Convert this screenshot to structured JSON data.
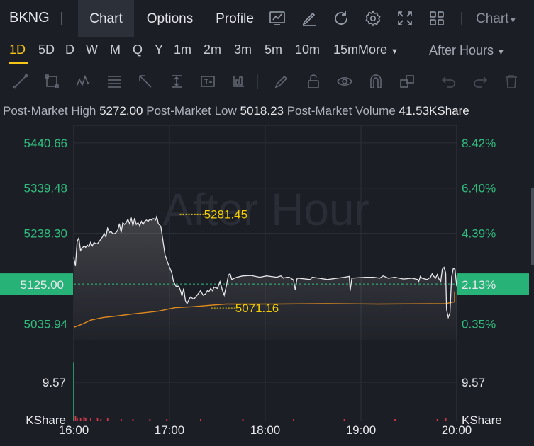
{
  "header": {
    "ticker": "BKNG",
    "tabs": [
      "Chart",
      "Options",
      "Profile"
    ],
    "chart_dropdown": "Chart",
    "icons": [
      "indicator-icon",
      "draw-icon",
      "refresh-icon",
      "settings-icon",
      "fullscreen-icon",
      "layout-grid-icon"
    ]
  },
  "timeframes": {
    "items": [
      "1D",
      "5D",
      "D",
      "W",
      "M",
      "Q",
      "Y",
      "1m",
      "2m",
      "3m",
      "5m",
      "10m",
      "15m"
    ],
    "more_label": "More",
    "selected": "1D",
    "session": "After Hours"
  },
  "drawing_tools": [
    "line-tool-icon",
    "rectangle-tool-icon",
    "pattern-tool-icon",
    "fibonacci-tool-icon",
    "arrow-tool-icon",
    "price-range-tool-icon",
    "text-tool-icon",
    "forecast-tool-icon",
    "pencil-icon",
    "lock-icon",
    "eye-icon",
    "magnet-icon",
    "duplicate-icon",
    "undo-icon",
    "redo-icon",
    "trash-icon"
  ],
  "stats": {
    "high_label": "Post-Market High",
    "high_value": "5272.00",
    "low_label": "Post-Market Low",
    "low_value": "5018.23",
    "volume_label": "Post-Market Volume",
    "volume_value": "41.53KShare"
  },
  "watermark": "After Hour",
  "colors": {
    "accent": "#f5c518",
    "green": "#2fbe7f",
    "price_line": "#e6e8ec",
    "avg_line": "#e08a1e",
    "background": "#1c1e25"
  },
  "chart_data": {
    "type": "line",
    "x_ticks": [
      "16:00",
      "17:00",
      "18:00",
      "19:00",
      "20:00"
    ],
    "y_ticks": [
      "5440.66",
      "5339.48",
      "5238.30",
      "5035.94"
    ],
    "pct_ticks": [
      "8.42%",
      "6.40%",
      "4.39%",
      "0.35%"
    ],
    "ylim": [
      5000,
      5480
    ],
    "xlim": [
      0,
      240
    ],
    "current_price": "5125.00",
    "current_pct": "2.13%",
    "high_marker": {
      "t": 61,
      "price": 5281.45,
      "label": "5281.45"
    },
    "low_marker": {
      "t": 79,
      "price": 5071.16,
      "label": "5071.16"
    },
    "series": [
      {
        "points": [
          [
            0,
            5185
          ],
          [
            2,
            5165
          ],
          [
            4,
            5220
          ],
          [
            6,
            5228
          ],
          [
            8,
            5200
          ],
          [
            10,
            5205
          ],
          [
            12,
            5210
          ],
          [
            14,
            5207
          ],
          [
            16,
            5212
          ],
          [
            18,
            5208
          ],
          [
            20,
            5218
          ],
          [
            22,
            5210
          ],
          [
            24,
            5218
          ],
          [
            26,
            5215
          ],
          [
            28,
            5215
          ],
          [
            30,
            5220
          ],
          [
            32,
            5225
          ],
          [
            34,
            5230
          ],
          [
            36,
            5238
          ],
          [
            38,
            5230
          ],
          [
            40,
            5250
          ],
          [
            42,
            5240
          ],
          [
            44,
            5242
          ],
          [
            46,
            5238
          ],
          [
            48,
            5237
          ],
          [
            50,
            5240
          ],
          [
            52,
            5245
          ],
          [
            54,
            5260
          ],
          [
            56,
            5240
          ],
          [
            58,
            5262
          ],
          [
            60,
            5258
          ],
          [
            62,
            5262
          ],
          [
            64,
            5270
          ],
          [
            66,
            5260
          ],
          [
            68,
            5272
          ],
          [
            70,
            5255
          ],
          [
            72,
            5272
          ],
          [
            74,
            5258
          ],
          [
            76,
            5262
          ],
          [
            78,
            5255
          ],
          [
            80,
            5265
          ],
          [
            82,
            5258
          ],
          [
            84,
            5265
          ],
          [
            86,
            5268
          ],
          [
            88,
            5265
          ],
          [
            90,
            5270
          ],
          [
            92,
            5268
          ],
          [
            94,
            5271
          ],
          [
            96,
            5270
          ],
          [
            97,
            5268
          ],
          [
            98,
            5275
          ],
          [
            99,
            5270
          ],
          [
            100,
            5260
          ],
          [
            103,
            5254
          ],
          [
            108,
            5190
          ],
          [
            112,
            5168
          ],
          [
            116,
            5150
          ],
          [
            118,
            5130
          ],
          [
            121,
            5120
          ],
          [
            124,
            5120
          ],
          [
            126,
            5112
          ],
          [
            128,
            5098
          ],
          [
            130,
            5115
          ],
          [
            132,
            5088
          ],
          [
            134,
            5081
          ],
          [
            138,
            5096
          ],
          [
            142,
            5091
          ],
          [
            146,
            5100
          ],
          [
            150,
            5110
          ],
          [
            153,
            5100
          ],
          [
            156,
            5103
          ],
          [
            158,
            5110
          ],
          [
            160,
            5108
          ],
          [
            162,
            5115
          ],
          [
            164,
            5110
          ],
          [
            166,
            5118
          ],
          [
            170,
            5115
          ],
          [
            173,
            5130
          ],
          [
            176,
            5110
          ],
          [
            178,
            5100
          ],
          [
            181,
            5125
          ],
          [
            183,
            5145
          ],
          [
            185,
            5148
          ],
          [
            187,
            5135
          ],
          [
            190,
            5138
          ],
          [
            193,
            5140
          ],
          [
            200,
            5143
          ],
          [
            210,
            5144
          ],
          [
            220,
            5140
          ],
          [
            228,
            5143
          ],
          [
            240,
            5140
          ],
          [
            245,
            5143
          ],
          [
            248,
            5138
          ],
          [
            252,
            5140
          ],
          [
            255,
            5140
          ],
          [
            260,
            5134
          ],
          [
            262,
            5112
          ],
          [
            264,
            5136
          ],
          [
            265,
            5138
          ],
          [
            280,
            5135
          ],
          [
            282,
            5140
          ],
          [
            290,
            5138
          ],
          [
            300,
            5135
          ],
          [
            312,
            5138
          ],
          [
            320,
            5140
          ],
          [
            326,
            5142
          ],
          [
            327,
            5110
          ],
          [
            329,
            5138
          ],
          [
            345,
            5140
          ],
          [
            355,
            5140
          ],
          [
            362,
            5138
          ],
          [
            366,
            5143
          ],
          [
            372,
            5138
          ],
          [
            380,
            5140
          ],
          [
            390,
            5136
          ],
          [
            400,
            5138
          ],
          [
            407,
            5135
          ],
          [
            408,
            5130
          ],
          [
            410,
            5142
          ],
          [
            412,
            5138
          ],
          [
            418,
            5135
          ],
          [
            422,
            5140
          ],
          [
            424,
            5148
          ],
          [
            426,
            5142
          ],
          [
            428,
            5138
          ],
          [
            430,
            5146
          ],
          [
            432,
            5136
          ],
          [
            434,
            5130
          ],
          [
            436,
            5158
          ],
          [
            438,
            5162
          ],
          [
            440,
            5150
          ],
          [
            441,
            5068
          ],
          [
            443,
            5050
          ],
          [
            445,
            5060
          ],
          [
            447,
            5140
          ],
          [
            449,
            5160
          ],
          [
            451,
            5158
          ],
          [
            453,
            5120
          ]
        ]
      },
      {
        "points": [
          [
            0,
            5028
          ],
          [
            10,
            5035
          ],
          [
            20,
            5044
          ],
          [
            35,
            5050
          ],
          [
            50,
            5053
          ],
          [
            70,
            5058
          ],
          [
            90,
            5062
          ],
          [
            100,
            5064
          ],
          [
            110,
            5068
          ],
          [
            120,
            5072
          ],
          [
            140,
            5074
          ],
          [
            180,
            5080
          ],
          [
            240,
            5080
          ],
          [
            300,
            5081
          ],
          [
            360,
            5080
          ],
          [
            440,
            5081
          ],
          [
            453,
            5085
          ],
          [
            460,
            5108
          ]
        ]
      }
    ],
    "volume": {
      "y_tick": "9.57",
      "unit": "KShare",
      "bars": [
        [
          0,
          80
        ],
        [
          2,
          6
        ],
        [
          4,
          4
        ],
        [
          8,
          3
        ],
        [
          12,
          5
        ],
        [
          14,
          4
        ],
        [
          20,
          3
        ],
        [
          28,
          4
        ],
        [
          32,
          2
        ],
        [
          40,
          3
        ],
        [
          56,
          2
        ],
        [
          70,
          2
        ],
        [
          90,
          2
        ],
        [
          110,
          2
        ],
        [
          150,
          2
        ],
        [
          200,
          2
        ],
        [
          260,
          2
        ],
        [
          320,
          2
        ],
        [
          380,
          2
        ],
        [
          430,
          2
        ],
        [
          440,
          3
        ]
      ]
    }
  }
}
